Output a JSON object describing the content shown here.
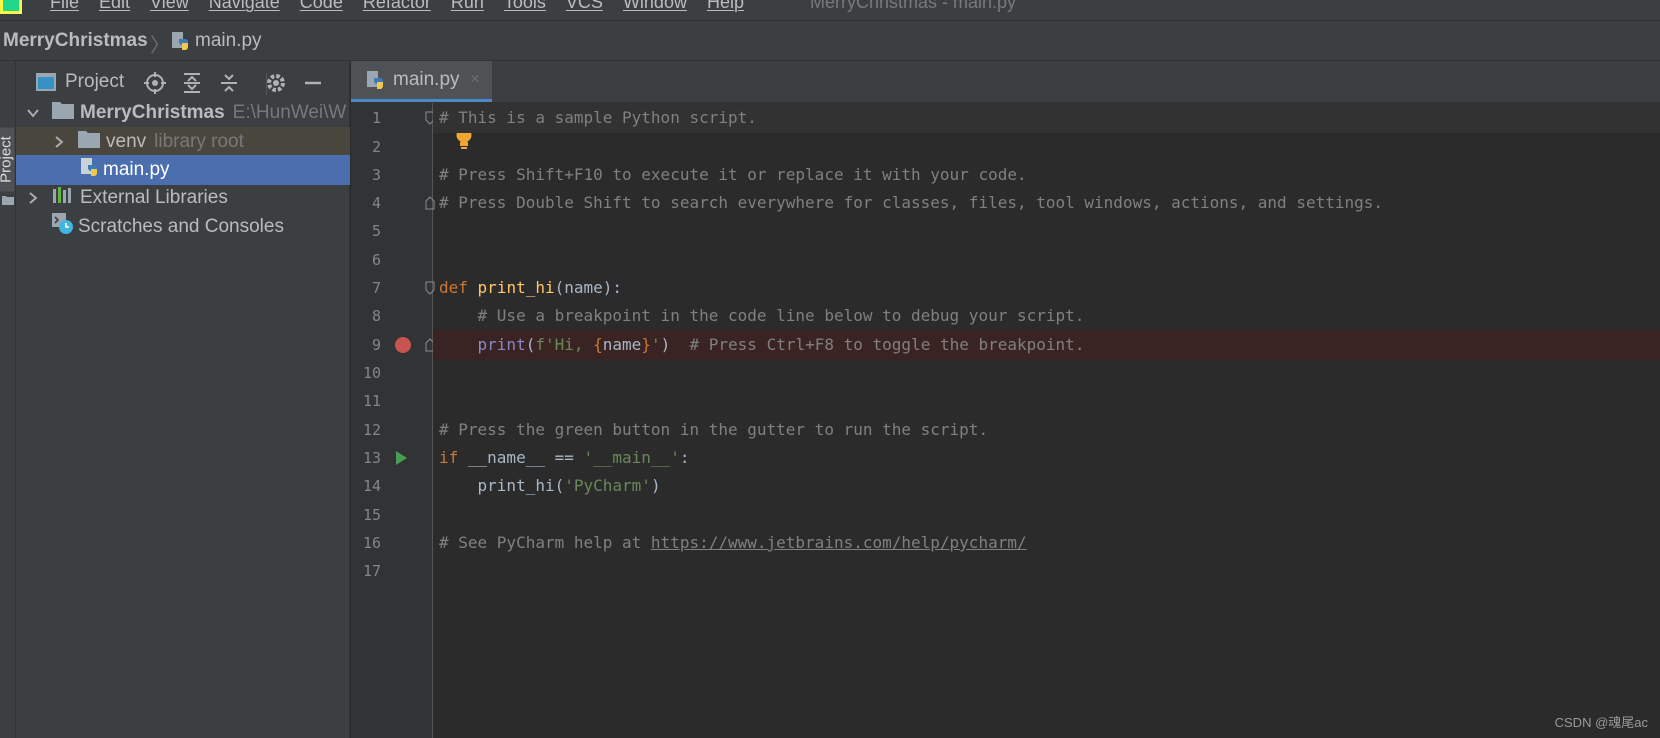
{
  "menubar": {
    "items": [
      "File",
      "Edit",
      "View",
      "Navigate",
      "Code",
      "Refactor",
      "Run",
      "Tools",
      "VCS",
      "Window",
      "Help"
    ],
    "window_title": "MerryChristmas - main.py"
  },
  "navbar": {
    "project": "MerryChristmas",
    "separator": "〉",
    "file": "main.py"
  },
  "left_strip": {
    "project_tab": "Project"
  },
  "project_panel": {
    "title": "Project",
    "tree": [
      {
        "label": "MerryChristmas",
        "hint": "E:\\HunWei\\W"
      },
      {
        "label": "venv",
        "hint": "library root"
      },
      {
        "label": "main.py",
        "hint": ""
      },
      {
        "label": "External Libraries",
        "hint": ""
      },
      {
        "label": "Scratches and Consoles",
        "hint": ""
      }
    ]
  },
  "editor": {
    "tab": {
      "label": "main.py",
      "close": "×"
    },
    "line_numbers": [
      "1",
      "2",
      "3",
      "4",
      "5",
      "6",
      "7",
      "8",
      "9",
      "10",
      "11",
      "12",
      "13",
      "14",
      "15",
      "16",
      "17"
    ],
    "code": {
      "l1": "# This is a sample Python script.",
      "l3": "# Press Shift+F10 to execute it or replace it with your code.",
      "l4": "# Press Double Shift to search everywhere for classes, files, tool windows, actions, and settings.",
      "l7_kw": "def",
      "l7_fn": "print_hi",
      "l7_rest": "(name):",
      "l8": "    # Use a breakpoint in the code line below to debug your script.",
      "l9_indent": "    ",
      "l9_builtin": "print",
      "l9_open": "(",
      "l9_str1": "f'Hi, ",
      "l9_brace1": "{",
      "l9_var": "name",
      "l9_brace2": "}",
      "l9_str2": "'",
      "l9_close": ")",
      "l9_comment": "  # Press Ctrl+F8 to toggle the breakpoint.",
      "l12": "# Press the green button in the gutter to run the script.",
      "l13_kw": "if",
      "l13_mid": " __name__ == ",
      "l13_str": "'__main__'",
      "l13_end": ":",
      "l14_call": "    print_hi(",
      "l14_str": "'PyCharm'",
      "l14_end": ")",
      "l16_text": "# See PyCharm help at ",
      "l16_link": "https://www.jetbrains.com/help/pycharm/"
    }
  },
  "watermark": "CSDN @魂尾ac",
  "colors": {
    "background": "#2b2b2b",
    "panel": "#3c3f41",
    "selection": "#4b6eaf",
    "breakpoint": "#c75450",
    "run": "#499c54",
    "keyword": "#cc7832",
    "function": "#ffc66d",
    "string": "#6a8759",
    "comment": "#808080"
  }
}
